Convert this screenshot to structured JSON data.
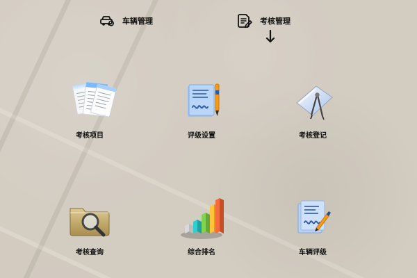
{
  "topbar": {
    "vehicle_management": "车辆管理",
    "assessment_management": "考核管理"
  },
  "grid": {
    "items": [
      {
        "label": "考核项目"
      },
      {
        "label": "评级设置"
      },
      {
        "label": "考核登记"
      },
      {
        "label": "考核查询"
      },
      {
        "label": "综合排名"
      },
      {
        "label": "车辆评级"
      }
    ]
  }
}
